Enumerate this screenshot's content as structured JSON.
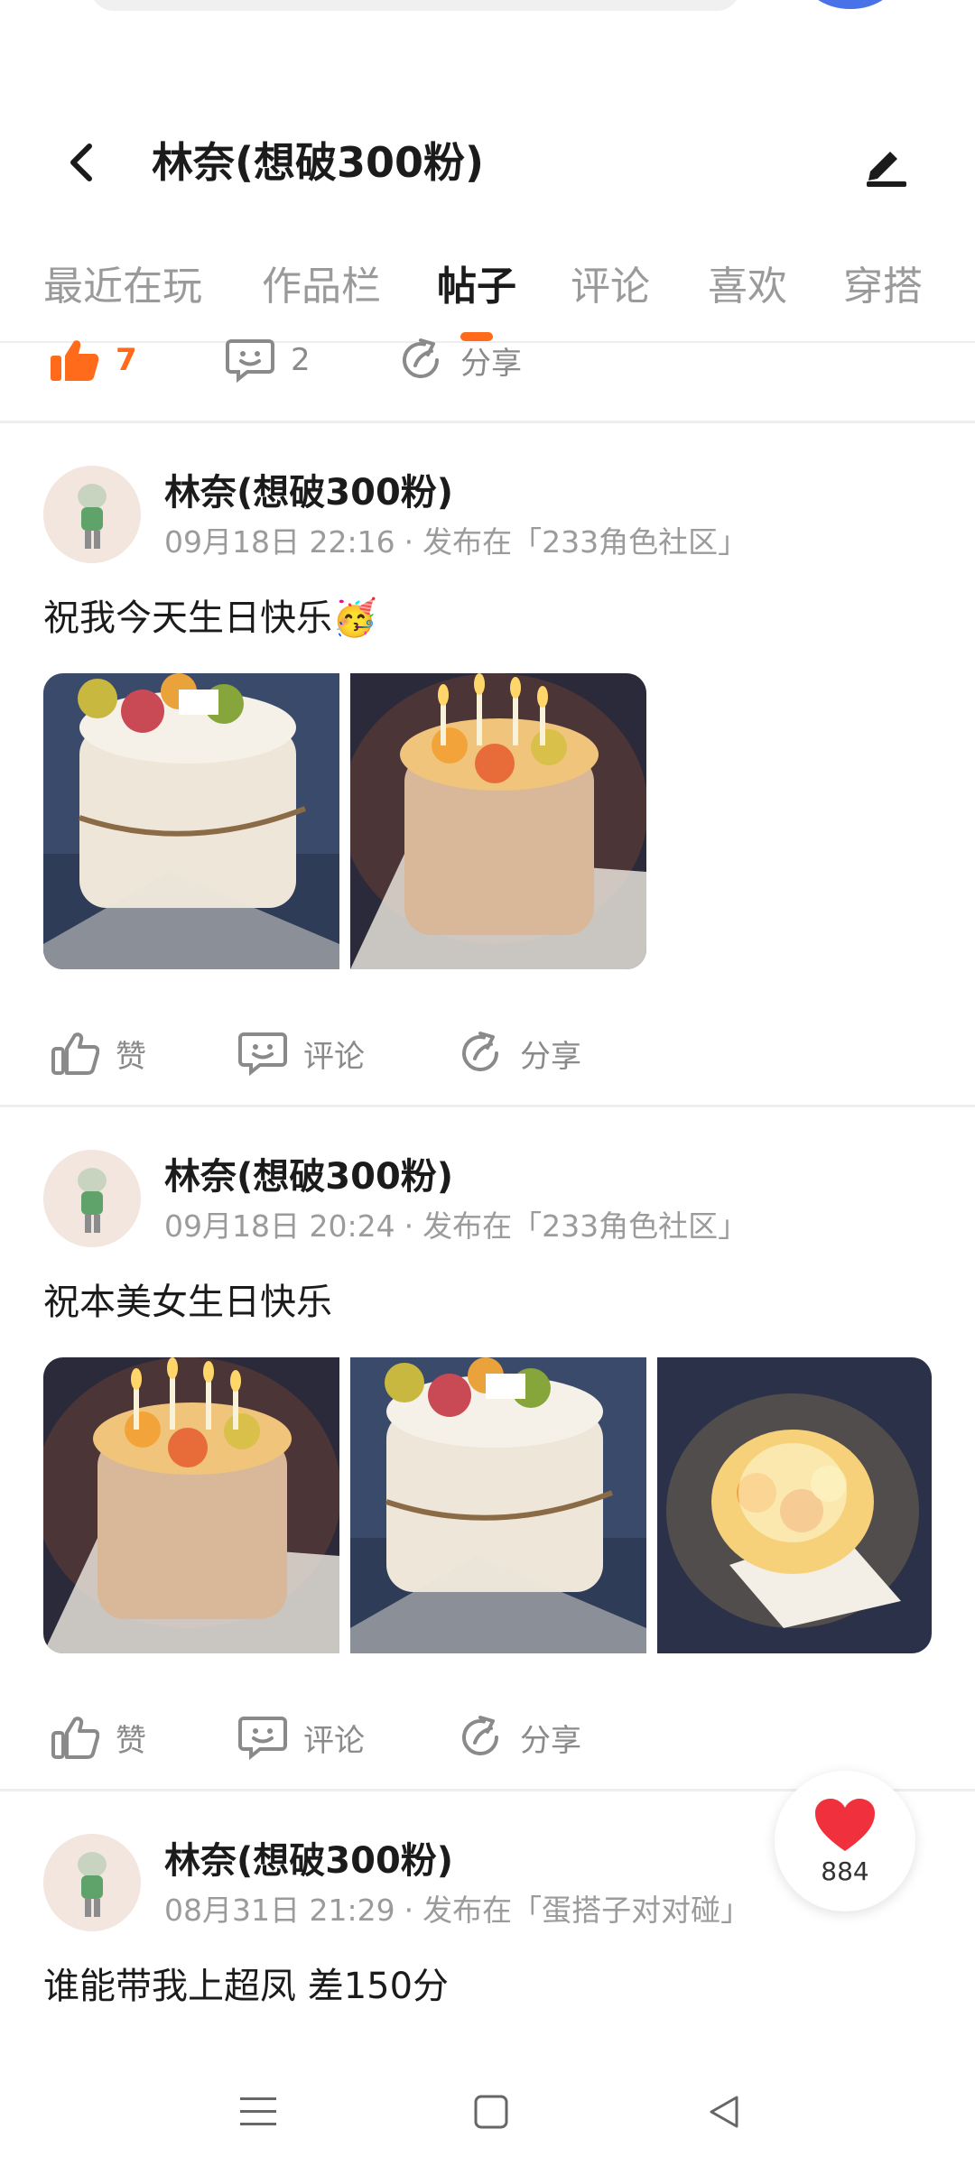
{
  "header": {
    "title": "林奈(想破300粉)"
  },
  "tabs": [
    "最近在玩",
    "作品栏",
    "帖子",
    "评论",
    "喜欢",
    "穿搭"
  ],
  "active_tab": "帖子",
  "prev_post_actions": {
    "like_count": "7",
    "comment_count": "2",
    "share_label": "分享"
  },
  "posts": [
    {
      "author": "林奈(想破300粉)",
      "time": "09月18日 22:16",
      "published_in": "发布在「233角色社区」",
      "text": "祝我今天生日快乐🥳",
      "actions": {
        "like": "赞",
        "comment": "评论",
        "share": "分享"
      }
    },
    {
      "author": "林奈(想破300粉)",
      "time": "09月18日 20:24",
      "published_in": "发布在「233角色社区」",
      "text": "祝本美女生日快乐",
      "actions": {
        "like": "赞",
        "comment": "评论",
        "share": "分享"
      }
    },
    {
      "author": "林奈(想破300粉)",
      "time": "08月31日 21:29",
      "published_in": "发布在「蛋搭子对对碰」",
      "text": "谁能带我上超凤  差150分"
    }
  ],
  "floating_like": {
    "count": "884"
  },
  "colors": {
    "accent": "#ff6b1a",
    "like_heart": "#f0303c"
  }
}
